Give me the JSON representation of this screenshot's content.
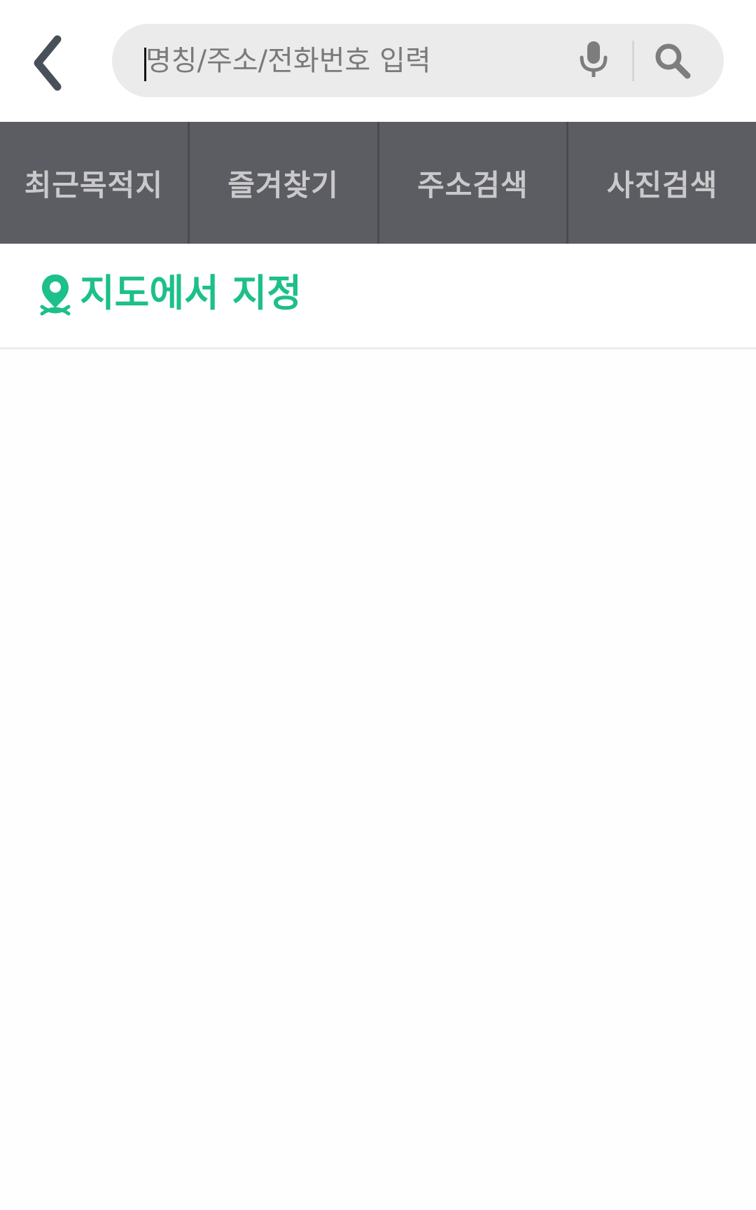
{
  "header": {
    "back_icon": "chevron-left-icon",
    "search": {
      "placeholder": "명칭/주소/전화번호 입력",
      "value": ""
    },
    "mic_icon": "microphone-icon",
    "search_icon": "magnifier-icon"
  },
  "tabs": [
    {
      "label": "최근목적지"
    },
    {
      "label": "즐겨찾기"
    },
    {
      "label": "주소검색"
    },
    {
      "label": "사진검색"
    }
  ],
  "map_select": {
    "icon": "map-pin-icon",
    "label": "지도에서 지정"
  },
  "colors": {
    "accent": "#1dbf8a",
    "tab_bar": "#5c5d62",
    "tab_text": "#c9c9cb",
    "search_bg": "#ebebeb"
  }
}
